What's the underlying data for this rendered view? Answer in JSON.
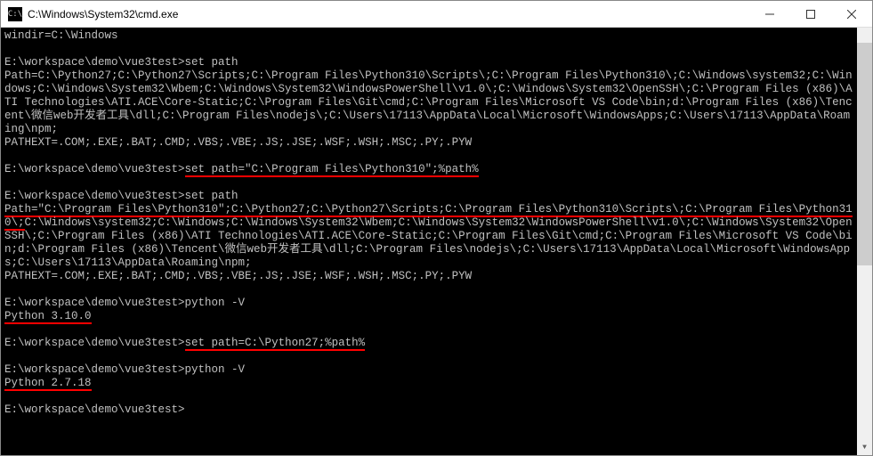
{
  "window": {
    "title": "C:\\Windows\\System32\\cmd.exe",
    "icon_label": "C:\\"
  },
  "terminal": {
    "lines": [
      {
        "text": "windir=C:\\Windows"
      },
      {
        "text": ""
      },
      {
        "prompt": "E:\\workspace\\demo\\vue3test>",
        "cmd": "set path"
      },
      {
        "text": "Path=C:\\Python27;C:\\Python27\\Scripts;C:\\Program Files\\Python310\\Scripts\\;C:\\Program Files\\Python310\\;C:\\Windows\\system32;C:\\Windows;C:\\Windows\\System32\\Wbem;C:\\Windows\\System32\\WindowsPowerShell\\v1.0\\;C:\\Windows\\System32\\OpenSSH\\;C:\\Program Files (x86)\\ATI Technologies\\ATI.ACE\\Core-Static;C:\\Program Files\\Git\\cmd;C:\\Program Files\\Microsoft VS Code\\bin;d:\\Program Files (x86)\\Tencent\\微信web开发者工具\\dll;C:\\Program Files\\nodejs\\;C:\\Users\\17113\\AppData\\Local\\Microsoft\\WindowsApps;C:\\Users\\17113\\AppData\\Roaming\\npm;"
      },
      {
        "text": "PATHEXT=.COM;.EXE;.BAT;.CMD;.VBS;.VBE;.JS;.JSE;.WSF;.WSH;.MSC;.PY;.PYW"
      },
      {
        "text": ""
      },
      {
        "prompt": "E:\\workspace\\demo\\vue3test>",
        "cmd": "set path=\"C:\\Program Files\\Python310\";%path%",
        "underline_cmd": true
      },
      {
        "text": ""
      },
      {
        "prompt": "E:\\workspace\\demo\\vue3test>",
        "cmd": "set path"
      },
      {
        "underline_prefix": "Path=\"C:\\Program Files\\Python310\";C:\\Python27;C:\\Python27\\Scripts;C:\\Program Files\\Python310\\Scripts\\;C:\\Program Files\\Python310\\;",
        "rest": "C:\\Windows\\system32;C:\\Windows;C:\\Windows\\System32\\Wbem;C:\\Windows\\System32\\WindowsPowerShell\\v1.0\\;C:\\Windows\\System32\\OpenSSH\\;C:\\Program Files (x86)\\ATI Technologies\\ATI.ACE\\Core-Static;C:\\Program Files\\Git\\cmd;C:\\Program Files\\Microsoft VS Code\\bin;d:\\Program Files (x86)\\Tencent\\微信web开发者工具\\dll;C:\\Program Files\\nodejs\\;C:\\Users\\17113\\AppData\\Local\\Microsoft\\WindowsApps;C:\\Users\\17113\\AppData\\Roaming\\npm;"
      },
      {
        "text": "PATHEXT=.COM;.EXE;.BAT;.CMD;.VBS;.VBE;.JS;.JSE;.WSF;.WSH;.MSC;.PY;.PYW"
      },
      {
        "text": ""
      },
      {
        "prompt": "E:\\workspace\\demo\\vue3test>",
        "cmd": "python -V"
      },
      {
        "text": "Python 3.10.0",
        "underline_full": true
      },
      {
        "text": ""
      },
      {
        "prompt": "E:\\workspace\\demo\\vue3test>",
        "cmd": "set path=C:\\Python27;%path%",
        "underline_cmd": true
      },
      {
        "text": ""
      },
      {
        "prompt": "E:\\workspace\\demo\\vue3test>",
        "cmd": "python -V"
      },
      {
        "text": "Python 2.7.18",
        "underline_full": true
      },
      {
        "text": ""
      },
      {
        "prompt": "E:\\workspace\\demo\\vue3test>",
        "cmd": ""
      }
    ]
  }
}
